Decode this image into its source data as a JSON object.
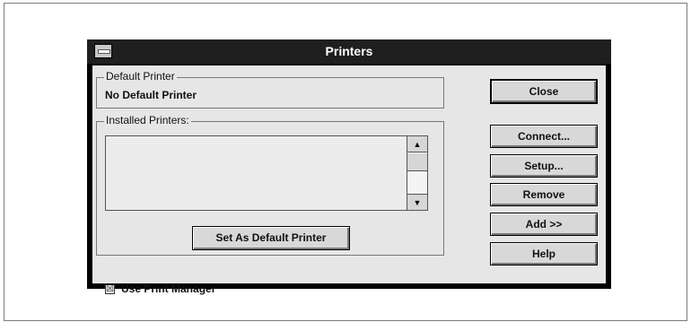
{
  "window": {
    "title": "Printers"
  },
  "default_printer": {
    "label": "Default Printer",
    "value": "No Default Printer"
  },
  "installed_printers": {
    "label": "Installed Printers:",
    "items": []
  },
  "buttons": {
    "set_default": "Set As Default Printer",
    "close": "Close",
    "connect": "Connect...",
    "setup": "Setup...",
    "remove": "Remove",
    "add": "Add >>",
    "help": "Help"
  },
  "checkbox": {
    "label": "Use Print Manager",
    "checked": true
  },
  "icons": {
    "system_menu": "system-menu-icon",
    "scroll_up": "▲",
    "scroll_down": "▼",
    "check": "☒"
  }
}
